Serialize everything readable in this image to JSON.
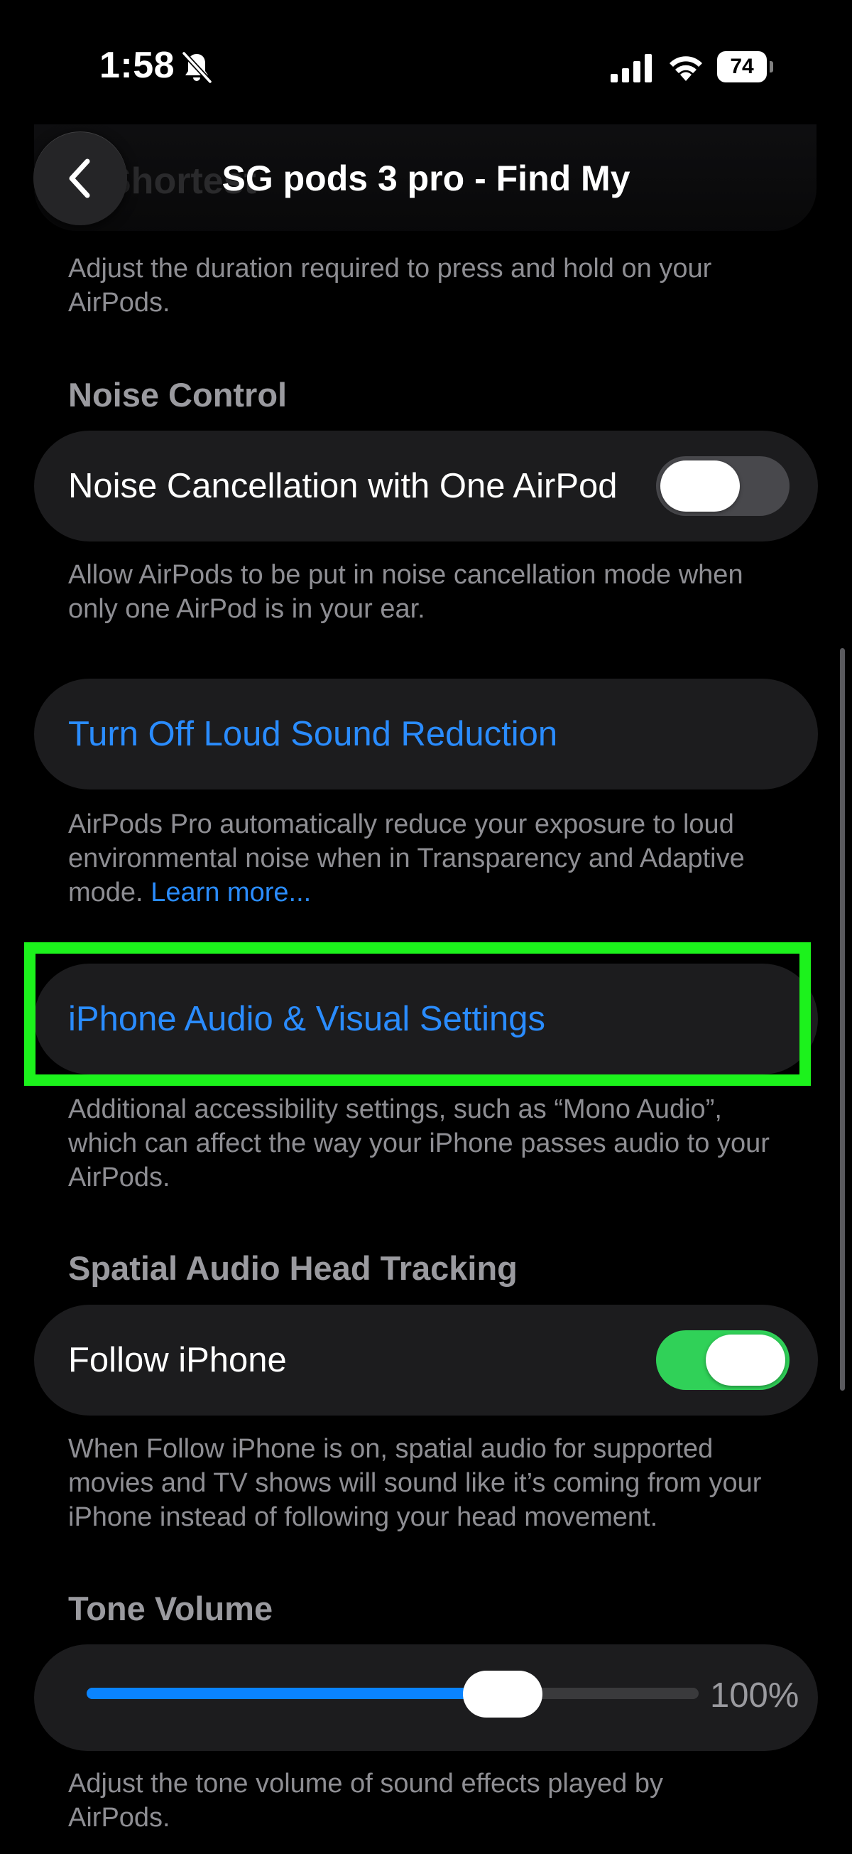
{
  "status_bar": {
    "time": "1:58",
    "battery": "74",
    "icons": [
      "bell-slash-icon",
      "cellular-signal-icon",
      "wifi-icon",
      "battery-icon"
    ]
  },
  "nav": {
    "title": "SG pods 3 pro - Find My",
    "ghost_text": "Shortest",
    "back_icon": "chevron-left-icon"
  },
  "press_hold": {
    "footer": "Adjust the duration required to press and hold on your AirPods."
  },
  "noise_control": {
    "header": "Noise Control",
    "row_label": "Noise Cancellation with One AirPod",
    "toggle_on": false,
    "footer": "Allow AirPods to be put in noise cancellation mode when only one AirPod is in your ear."
  },
  "loud_sound": {
    "link": "Turn Off Loud Sound Reduction",
    "footer": "AirPods Pro automatically reduce your exposure to loud environmental noise when in Transparency and Adaptive mode.",
    "learn_more": "Learn more..."
  },
  "audio_visual": {
    "link": "iPhone Audio & Visual Settings",
    "footer": "Additional accessibility settings, such as “Mono Audio”, which can affect the way your iPhone passes audio to your AirPods."
  },
  "spatial_audio": {
    "header": "Spatial Audio Head Tracking",
    "row_label": "Follow iPhone",
    "toggle_on": true,
    "footer": "When Follow iPhone is on, spatial audio for supported movies and TV shows will sound like it’s coming from your iPhone instead of following your head movement."
  },
  "tone_volume": {
    "header": "Tone Volume",
    "value_label": "100%",
    "slider_level": 0.68,
    "footer": "Adjust the tone volume of sound effects played by AirPods."
  },
  "colors": {
    "accent_blue": "#2a8cff",
    "toggle_on_green": "#30d158",
    "highlight_green": "#1cf21c",
    "card_bg": "#1c1c1e"
  }
}
